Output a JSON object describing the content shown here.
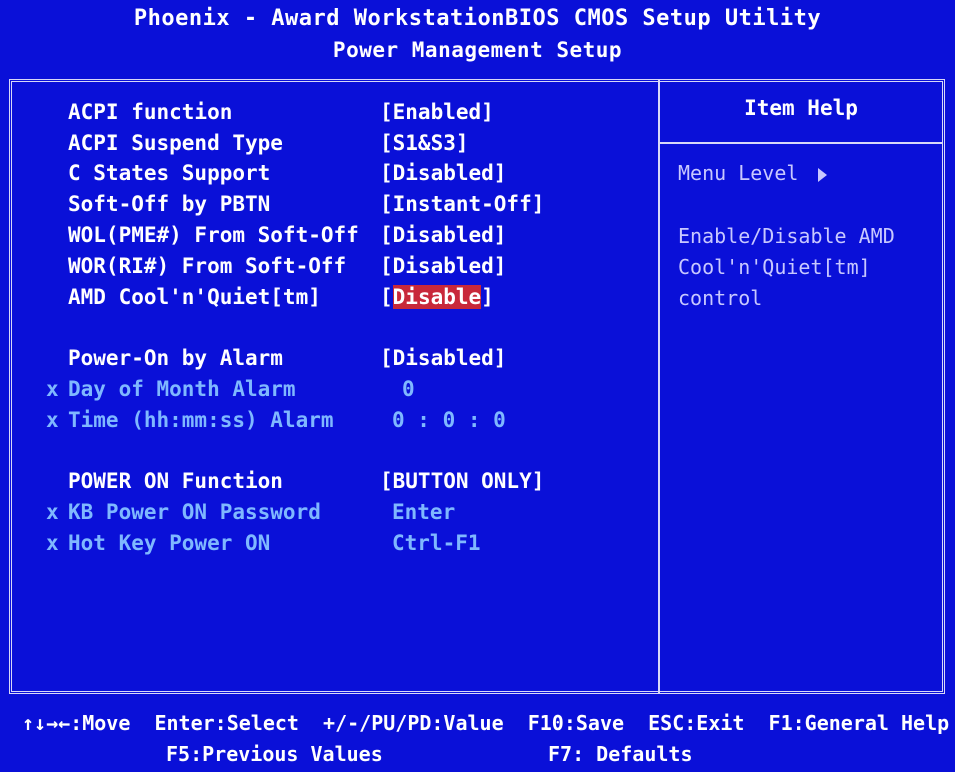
{
  "header": {
    "line1": "Phoenix - Award WorkstationBIOS CMOS Setup Utility",
    "line2": "Power Management Setup"
  },
  "settings": [
    {
      "label": "ACPI function",
      "value": "[Enabled]"
    },
    {
      "label": "ACPI Suspend Type",
      "value": "[S1&S3]"
    },
    {
      "label": "C States Support",
      "value": "[Disabled]"
    },
    {
      "label": "Soft-Off by PBTN",
      "value": "[Instant-Off]"
    },
    {
      "label": "WOL(PME#) From Soft-Off",
      "value": "[Disabled]"
    },
    {
      "label": "WOR(RI#) From Soft-Off",
      "value": "[Disabled]"
    },
    {
      "label": "AMD Cool'n'Quiet[tm]",
      "value_open": "[",
      "value_selected": "Disable",
      "value_close": "]"
    },
    {
      "label": "Power-On by Alarm",
      "value": "[Disabled]"
    },
    {
      "prefix": "x",
      "label": "Day of Month Alarm",
      "value": "0"
    },
    {
      "prefix": "x",
      "label": "Time (hh:mm:ss) Alarm",
      "value": "0 : 0 : 0"
    },
    {
      "label": "POWER ON Function",
      "value": "[BUTTON ONLY]"
    },
    {
      "prefix": "x",
      "label": "KB Power ON Password",
      "value": "Enter"
    },
    {
      "prefix": "x",
      "label": "Hot Key Power ON",
      "value": "Ctrl-F1"
    }
  ],
  "help": {
    "title": "Item Help",
    "menu_level": "Menu Level",
    "description": [
      "Enable/Disable AMD",
      "Cool'n'Quiet[tm]",
      "control"
    ]
  },
  "footer": {
    "line1": "↑↓→←:Move  Enter:Select  +/-/PU/PD:Value  F10:Save  ESC:Exit  F1:General Help",
    "line2_left": "F5:Previous Values",
    "line2_right": "F7: Defaults"
  },
  "colors": {
    "background": "#0a10d8",
    "text": "#ffffff",
    "disabled_text": "#7fb8ff",
    "highlight": "#c8283a"
  }
}
